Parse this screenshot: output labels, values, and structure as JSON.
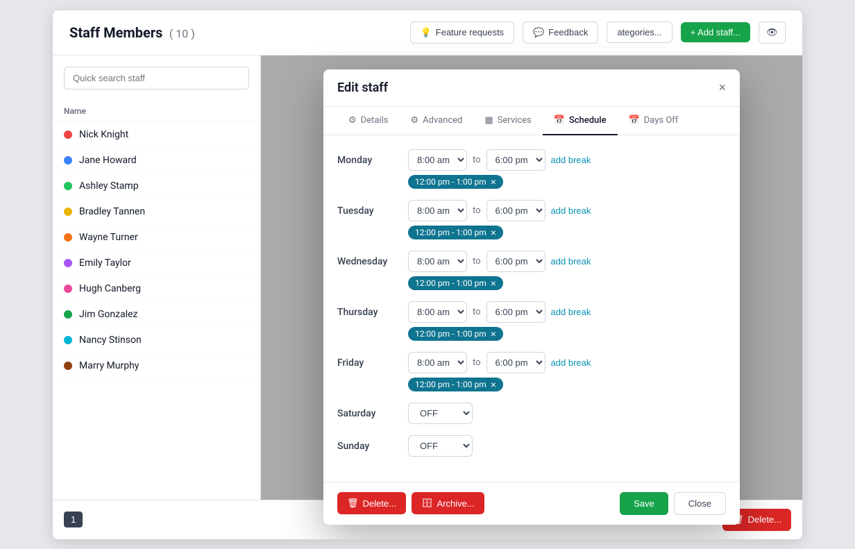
{
  "app": {
    "title": "Staff Members",
    "count": "( 10 )"
  },
  "topbar": {
    "feature_requests": "Feature requests",
    "feedback": "Feedback",
    "categories_btn": "ategories...",
    "add_staff_btn": "+ Add staff..."
  },
  "sidebar": {
    "search_placeholder": "Quick search staff",
    "name_header": "Name",
    "staff": [
      {
        "name": "Nick Knight",
        "color": "#ef4444"
      },
      {
        "name": "Jane Howard",
        "color": "#3b82f6"
      },
      {
        "name": "Ashley Stamp",
        "color": "#22c55e"
      },
      {
        "name": "Bradley Tannen",
        "color": "#eab308"
      },
      {
        "name": "Wayne Turner",
        "color": "#f97316"
      },
      {
        "name": "Emily Taylor",
        "color": "#a855f7"
      },
      {
        "name": "Hugh Canberg",
        "color": "#ec4899"
      },
      {
        "name": "Jim Gonzalez",
        "color": "#16a34a"
      },
      {
        "name": "Nancy Stinson",
        "color": "#06b6d4"
      },
      {
        "name": "Marry Murphy",
        "color": "#92400e"
      }
    ]
  },
  "modal": {
    "title": "Edit staff",
    "close_label": "×",
    "tabs": [
      {
        "label": "Details",
        "icon": "⚙",
        "id": "details"
      },
      {
        "label": "Advanced",
        "icon": "⚙",
        "id": "advanced"
      },
      {
        "label": "Services",
        "icon": "▦",
        "id": "services"
      },
      {
        "label": "Schedule",
        "icon": "📅",
        "id": "schedule",
        "active": true
      },
      {
        "label": "Days Off",
        "icon": "📅",
        "id": "daysoff"
      }
    ],
    "schedule": {
      "days": [
        {
          "label": "Monday",
          "type": "time",
          "start": "8:00 am",
          "end": "6:00 pm",
          "break": "12:00 pm - 1:00 pm"
        },
        {
          "label": "Tuesday",
          "type": "time",
          "start": "8:00 am",
          "end": "6:00 pm",
          "break": "12:00 pm - 1:00 pm"
        },
        {
          "label": "Wednesday",
          "type": "time",
          "start": "8:00 am",
          "end": "6:00 pm",
          "break": "12:00 pm - 1:00 pm"
        },
        {
          "label": "Thursday",
          "type": "time",
          "start": "8:00 am",
          "end": "6:00 pm",
          "break": "12:00 pm - 1:00 pm"
        },
        {
          "label": "Friday",
          "type": "time",
          "start": "8:00 am",
          "end": "6:00 pm",
          "break": "12:00 pm - 1:00 pm"
        },
        {
          "label": "Saturday",
          "type": "off"
        },
        {
          "label": "Sunday",
          "type": "off"
        }
      ],
      "add_break_label": "add break",
      "to_label": "to",
      "off_value": "OFF"
    },
    "footer": {
      "delete_btn": "Delete...",
      "archive_btn": "Archive...",
      "save_btn": "Save",
      "close_btn": "Close"
    }
  },
  "bottom": {
    "page": "1",
    "delete_btn": "Delete..."
  }
}
